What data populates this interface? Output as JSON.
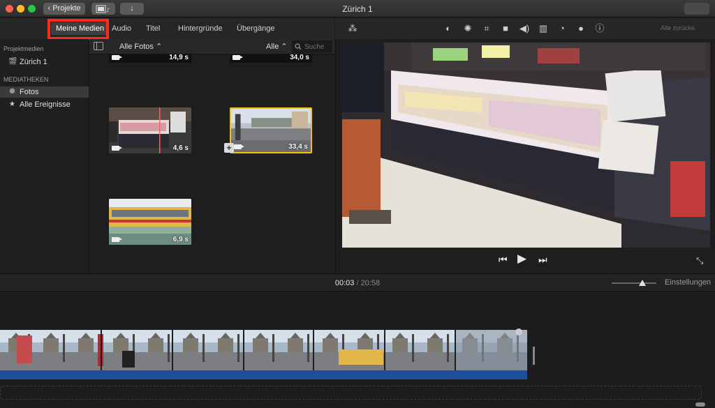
{
  "window": {
    "title": "Zürich 1",
    "back_label": "Projekte"
  },
  "tabs": [
    {
      "label": "Meine Medien",
      "active": true
    },
    {
      "label": "Audio"
    },
    {
      "label": "Titel"
    },
    {
      "label": "Hintergründe"
    },
    {
      "label": "Übergänge"
    }
  ],
  "sidebar": {
    "section_projects": "Projektmedien",
    "project_item": "Zürich 1",
    "section_libraries": "MEDIATHEKEN",
    "items": [
      {
        "label": "Fotos",
        "icon": "photos-icon",
        "selected": true
      },
      {
        "label": "Alle Ereignisse",
        "icon": "star-icon"
      }
    ]
  },
  "browser": {
    "filter": "Alle Fotos",
    "filter_all": "Alle",
    "search_placeholder": "Suche",
    "clips": [
      {
        "duration": "14,9 s"
      },
      {
        "duration": "34,0 s"
      },
      {
        "duration": "4,6 s"
      },
      {
        "duration": "33,4 s",
        "selected": true
      },
      {
        "duration": "6,9 s"
      }
    ]
  },
  "viewer": {
    "reset_label": "Alle zurücks."
  },
  "timeline": {
    "current_time": "00:03",
    "separator": "/",
    "total_time": "20:58",
    "settings_label": "Einstellungen"
  },
  "colors": {
    "highlight_box": "#ff2a17",
    "selection": "#f3c500",
    "audio_track": "#1f4e9a"
  }
}
